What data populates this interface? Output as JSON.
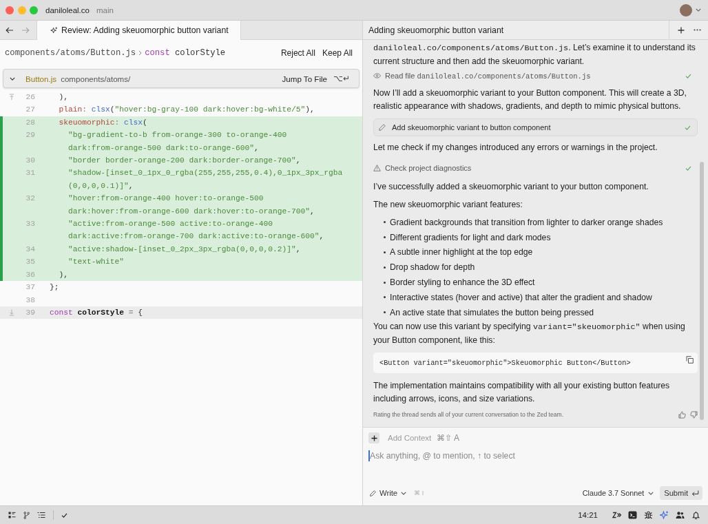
{
  "titlebar": {
    "project": "daniloleal.co",
    "branch": "main"
  },
  "editor": {
    "nav": [
      {
        "disabled": false
      },
      {
        "disabled": true
      }
    ],
    "tabs": [
      {
        "label": "Review: Adding skeuomorphic button variant",
        "selected": true
      }
    ],
    "breadcrumb": {
      "path": "components/atoms/Button.js",
      "symbol": [
        {
          "kind": "keyword",
          "text": "const"
        },
        {
          "kind": "plain",
          "text": " colorStyle"
        }
      ]
    },
    "actions": [
      "Reject All",
      "Keep All"
    ],
    "file": {
      "name": "Button.js",
      "dir": "components/atoms/",
      "expanded": true,
      "jump": "Jump To File",
      "shortcut": "⌥↵"
    },
    "expand_above": true,
    "expand_below": true,
    "lines": [
      {
        "number": "26",
        "added": false,
        "current": false,
        "rows": [
          [
            {
              "kind": "plain",
              "text": "  ),"
            }
          ]
        ]
      },
      {
        "number": "27",
        "added": false,
        "current": false,
        "rows": [
          [
            {
              "kind": "property",
              "text": "  plain"
            },
            {
              "kind": "punct",
              "text": ": "
            },
            {
              "kind": "function",
              "text": "clsx"
            },
            {
              "kind": "plain",
              "text": "("
            },
            {
              "kind": "string",
              "text": "\"hover:bg-gray-100 dark:hover:bg-white/5\""
            },
            {
              "kind": "plain",
              "text": "),"
            }
          ]
        ]
      },
      {
        "number": "28",
        "added": true,
        "current": false,
        "rows": [
          [
            {
              "kind": "property",
              "text": "  skeuomorphic"
            },
            {
              "kind": "punct",
              "text": ": "
            },
            {
              "kind": "function",
              "text": "clsx"
            },
            {
              "kind": "plain",
              "text": "("
            }
          ]
        ]
      },
      {
        "number": "29",
        "added": true,
        "current": false,
        "rows": [
          [
            {
              "kind": "string",
              "text": "    \"bg-gradient-to-b from-orange-300 to-orange-400"
            }
          ],
          [
            {
              "kind": "string",
              "text": "dark:from-orange-500 dark:to-orange-600\""
            },
            {
              "kind": "plain",
              "text": ","
            }
          ]
        ]
      },
      {
        "number": "30",
        "added": true,
        "current": false,
        "rows": [
          [
            {
              "kind": "string",
              "text": "    \"border border-orange-200 dark:border-orange-700\""
            },
            {
              "kind": "plain",
              "text": ","
            }
          ]
        ]
      },
      {
        "number": "31",
        "added": true,
        "current": false,
        "rows": [
          [
            {
              "kind": "string",
              "text": "    \"shadow-[inset_0_1px_0_rgba(255,255,255,0.4),0_1px_3px_rgba"
            }
          ],
          [
            {
              "kind": "string",
              "text": "(0,0,0,0.1)]\""
            },
            {
              "kind": "plain",
              "text": ","
            }
          ]
        ]
      },
      {
        "number": "32",
        "added": true,
        "current": false,
        "rows": [
          [
            {
              "kind": "string",
              "text": "    \"hover:from-orange-400 hover:to-orange-500"
            }
          ],
          [
            {
              "kind": "string",
              "text": "dark:hover:from-orange-600 dark:hover:to-orange-700\""
            },
            {
              "kind": "plain",
              "text": ","
            }
          ]
        ]
      },
      {
        "number": "33",
        "added": true,
        "current": false,
        "rows": [
          [
            {
              "kind": "string",
              "text": "    \"active:from-orange-500 active:to-orange-400"
            }
          ],
          [
            {
              "kind": "string",
              "text": "dark:active:from-orange-700 dark:active:to-orange-600\""
            },
            {
              "kind": "plain",
              "text": ","
            }
          ]
        ]
      },
      {
        "number": "34",
        "added": true,
        "current": false,
        "rows": [
          [
            {
              "kind": "string",
              "text": "    \"active:shadow-[inset_0_2px_3px_rgba(0,0,0,0.2)]\""
            },
            {
              "kind": "plain",
              "text": ","
            }
          ]
        ]
      },
      {
        "number": "35",
        "added": true,
        "current": false,
        "rows": [
          [
            {
              "kind": "string",
              "text": "    \"text-white\""
            }
          ]
        ]
      },
      {
        "number": "36",
        "added": true,
        "current": false,
        "rows": [
          [
            {
              "kind": "plain",
              "text": "  ),"
            }
          ]
        ]
      },
      {
        "number": "37",
        "added": false,
        "current": false,
        "rows": [
          [
            {
              "kind": "plain",
              "text": "};"
            }
          ]
        ]
      },
      {
        "number": "38",
        "added": false,
        "current": false
      },
      {
        "number": "39",
        "added": false,
        "current": true,
        "rows": [
          [
            {
              "kind": "keyword",
              "text": "const"
            },
            {
              "kind": "variable",
              "text": " colorStyle"
            },
            {
              "kind": "punct",
              "text": " = "
            },
            {
              "kind": "plain",
              "text": "{"
            }
          ]
        ]
      }
    ]
  },
  "assistant": {
    "title": "Adding skeuomorphic button variant",
    "blocks": [
      {
        "kind": "paragraph",
        "parts": [
          {
            "code": true,
            "text": "daniloleal.co/components/atoms/Button.js"
          },
          {
            "code": false,
            "text": ". Let’s examine it to understand its current structure and then add the skeuomorphic variant."
          }
        ]
      },
      {
        "kind": "read",
        "done": true,
        "parts": [
          {
            "code": false,
            "text": "Read file "
          },
          {
            "code": true,
            "text": "daniloleal.co/components/atoms/Button.js"
          }
        ]
      },
      {
        "kind": "paragraph",
        "parts": [
          {
            "code": false,
            "text": "Now I’ll add a skeuomorphic variant to your Button component. This will create a 3D, realistic appearance with shadows, gradients, and depth to mimic physical buttons."
          }
        ]
      },
      {
        "kind": "edit",
        "done": true,
        "parts": [
          {
            "code": false,
            "text": "Add skeuomorphic variant to button component"
          }
        ]
      },
      {
        "kind": "paragraph",
        "parts": [
          {
            "code": false,
            "text": "Let me check if my changes introduced any errors or warnings in the project."
          }
        ]
      },
      {
        "kind": "diagnostics",
        "done": true,
        "parts": [
          {
            "code": false,
            "text": "Check project diagnostics"
          }
        ]
      },
      {
        "kind": "paragraph",
        "parts": [
          {
            "code": false,
            "text": "I’ve successfully added a skeuomorphic variant to your button component."
          }
        ]
      },
      {
        "kind": "paragraph",
        "parts": [
          {
            "code": false,
            "text": "The new skeuomorphic variant features:"
          }
        ]
      },
      {
        "kind": "list",
        "items": [
          "Gradient backgrounds that transition from lighter to darker orange shades",
          "Different gradients for light and dark modes",
          "A subtle inner highlight at the top edge",
          "Drop shadow for depth",
          "Border styling to enhance the 3D effect",
          "Interactive states (hover and active) that alter the gradient and shadow",
          "An active state that simulates the button being pressed"
        ]
      },
      {
        "kind": "paragraph",
        "parts": [
          {
            "code": false,
            "text": "You can now use this variant by specifying "
          },
          {
            "code": true,
            "text": "variant=\"skeuomorphic\""
          },
          {
            "code": false,
            "text": " when using your Button component, like this:"
          }
        ]
      },
      {
        "kind": "code",
        "text": "<Button variant=\"skeuomorphic\">Skeuomorphic Button</Button>"
      },
      {
        "kind": "paragraph",
        "parts": [
          {
            "code": false,
            "text": "The implementation maintains compatibility with all your existing button features including arrows, icons, and size variations."
          }
        ]
      }
    ],
    "notice": "Rating the thread sends all of your current conversation to the Zed team."
  },
  "composer": {
    "add_context": "Add Context",
    "add_context_shortcut": "⌘⇧ A",
    "placeholder": "Ask anything, @ to mention, ↑ to select",
    "mode": "Write",
    "mode_shortcut": "⌘ I",
    "model": "Claude 3.7 Sonnet",
    "submit": "Submit"
  },
  "status_bar": {
    "time": "14:21",
    "tools": [
      {
        "selected": false
      },
      {
        "selected": false
      },
      {
        "selected": false
      },
      {
        "selected": true
      },
      {
        "selected": false
      },
      {
        "selected": false
      }
    ]
  }
}
